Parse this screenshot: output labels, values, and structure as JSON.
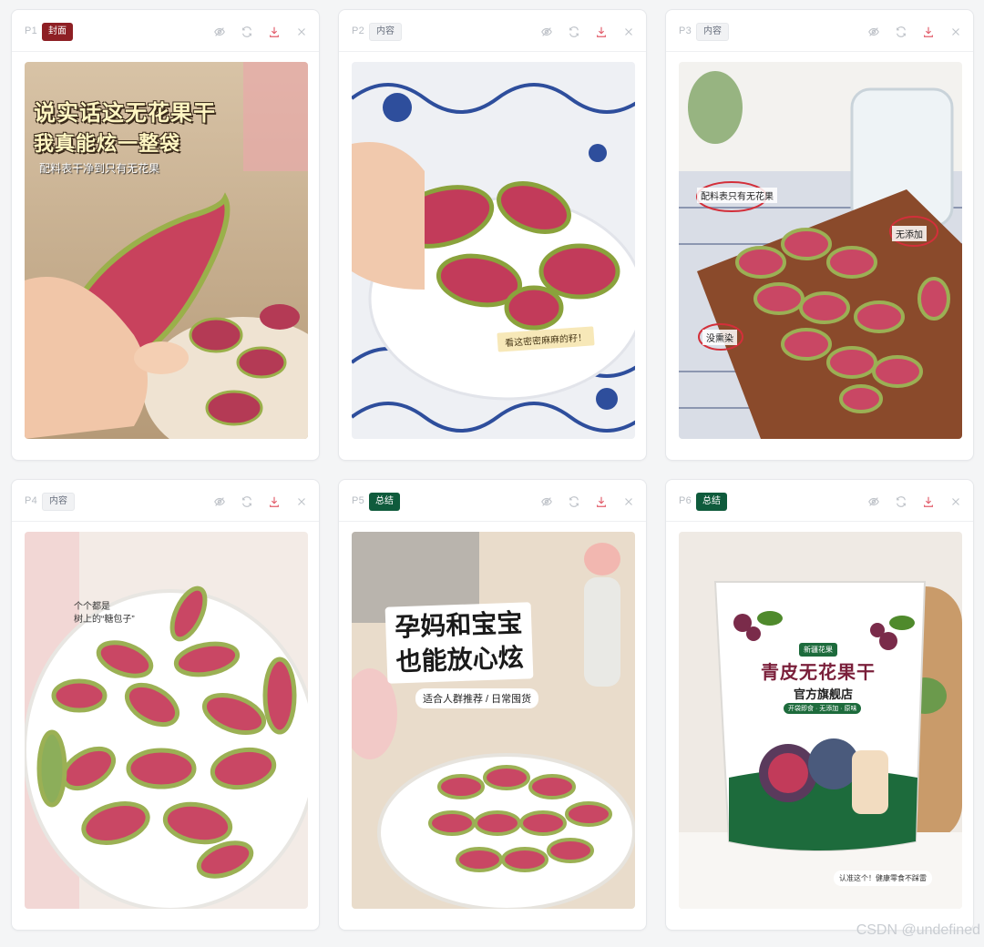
{
  "cards": [
    {
      "page": "P1",
      "tag": "封面",
      "tag_kind": "cover",
      "overlay": {
        "line1": "说实话这无花果干",
        "line2": "我真能炫一整袋",
        "line3": "配料表干净到只有无花果"
      }
    },
    {
      "page": "P2",
      "tag": "内容",
      "tag_kind": "content",
      "overlay": {
        "caption": "看这密密麻麻的籽！"
      }
    },
    {
      "page": "P3",
      "tag": "内容",
      "tag_kind": "content",
      "overlay": {
        "note1": "配料表只有无花果",
        "note2": "无添加",
        "note3": "没熏染"
      }
    },
    {
      "page": "P4",
      "tag": "内容",
      "tag_kind": "content",
      "overlay": {
        "note": "个个都是\n树上的“糖包子”"
      }
    },
    {
      "page": "P5",
      "tag": "总结",
      "tag_kind": "summary",
      "overlay": {
        "title": "孕妈和宝宝\n也能放心炫",
        "subtitle": "适合人群推荐 / 日常囤货"
      }
    },
    {
      "page": "P6",
      "tag": "总结",
      "tag_kind": "summary",
      "overlay": {
        "brand": "新疆花果",
        "title": "青皮无花果干",
        "store": "官方旗舰店",
        "strip": "开袋即食 · 无添加 · 原味",
        "footer": "认准这个！健康零食不踩雷"
      }
    }
  ],
  "toolbar_icons": [
    "eye-off-icon",
    "refresh-icon",
    "download-icon",
    "close-icon"
  ],
  "watermark": "CSDN @undefined",
  "colors": {
    "cover": "#8e1f24",
    "summary": "#0f5b3c",
    "download": "#e25d6b"
  }
}
